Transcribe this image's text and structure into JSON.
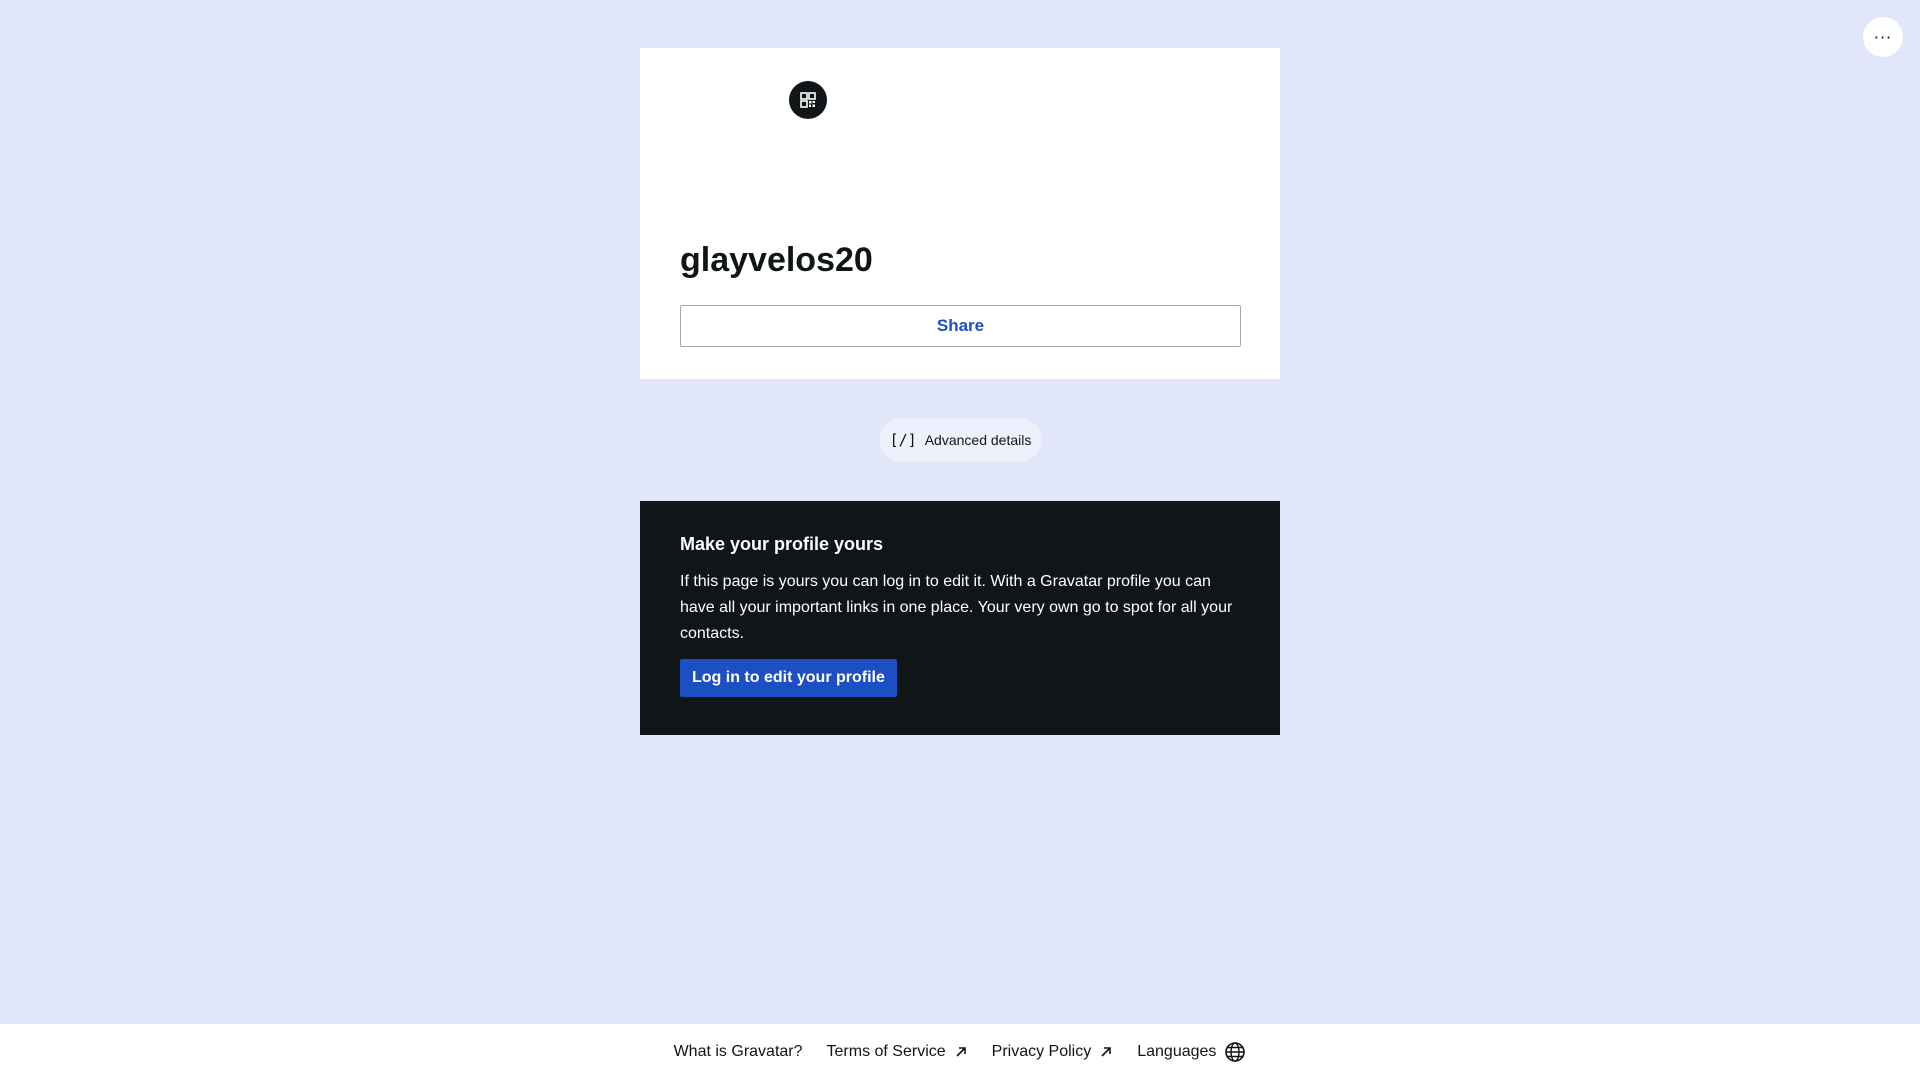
{
  "header": {
    "more_label": "···"
  },
  "profile": {
    "username": "glayvelos20",
    "share_label": "Share"
  },
  "advanced": {
    "glyph": "[/]",
    "label": "Advanced details"
  },
  "promo": {
    "title": "Make your profile yours",
    "body": "If this page is yours you can log in to edit it. With a Gravatar profile you can have all your important links in one place. Your very own go to spot for all your contacts.",
    "login_label": "Log in to edit your profile"
  },
  "footer": {
    "links": [
      {
        "label": "What is Gravatar?",
        "icon": ""
      },
      {
        "label": "Terms of Service",
        "icon": "external-arrow-icon"
      },
      {
        "label": "Privacy Policy",
        "icon": "external-arrow-icon"
      },
      {
        "label": "Languages",
        "icon": "globe-icon"
      }
    ]
  },
  "colors": {
    "page_bg": "#e1e7f8",
    "accent": "#1d4fc4",
    "dark": "#101517"
  }
}
